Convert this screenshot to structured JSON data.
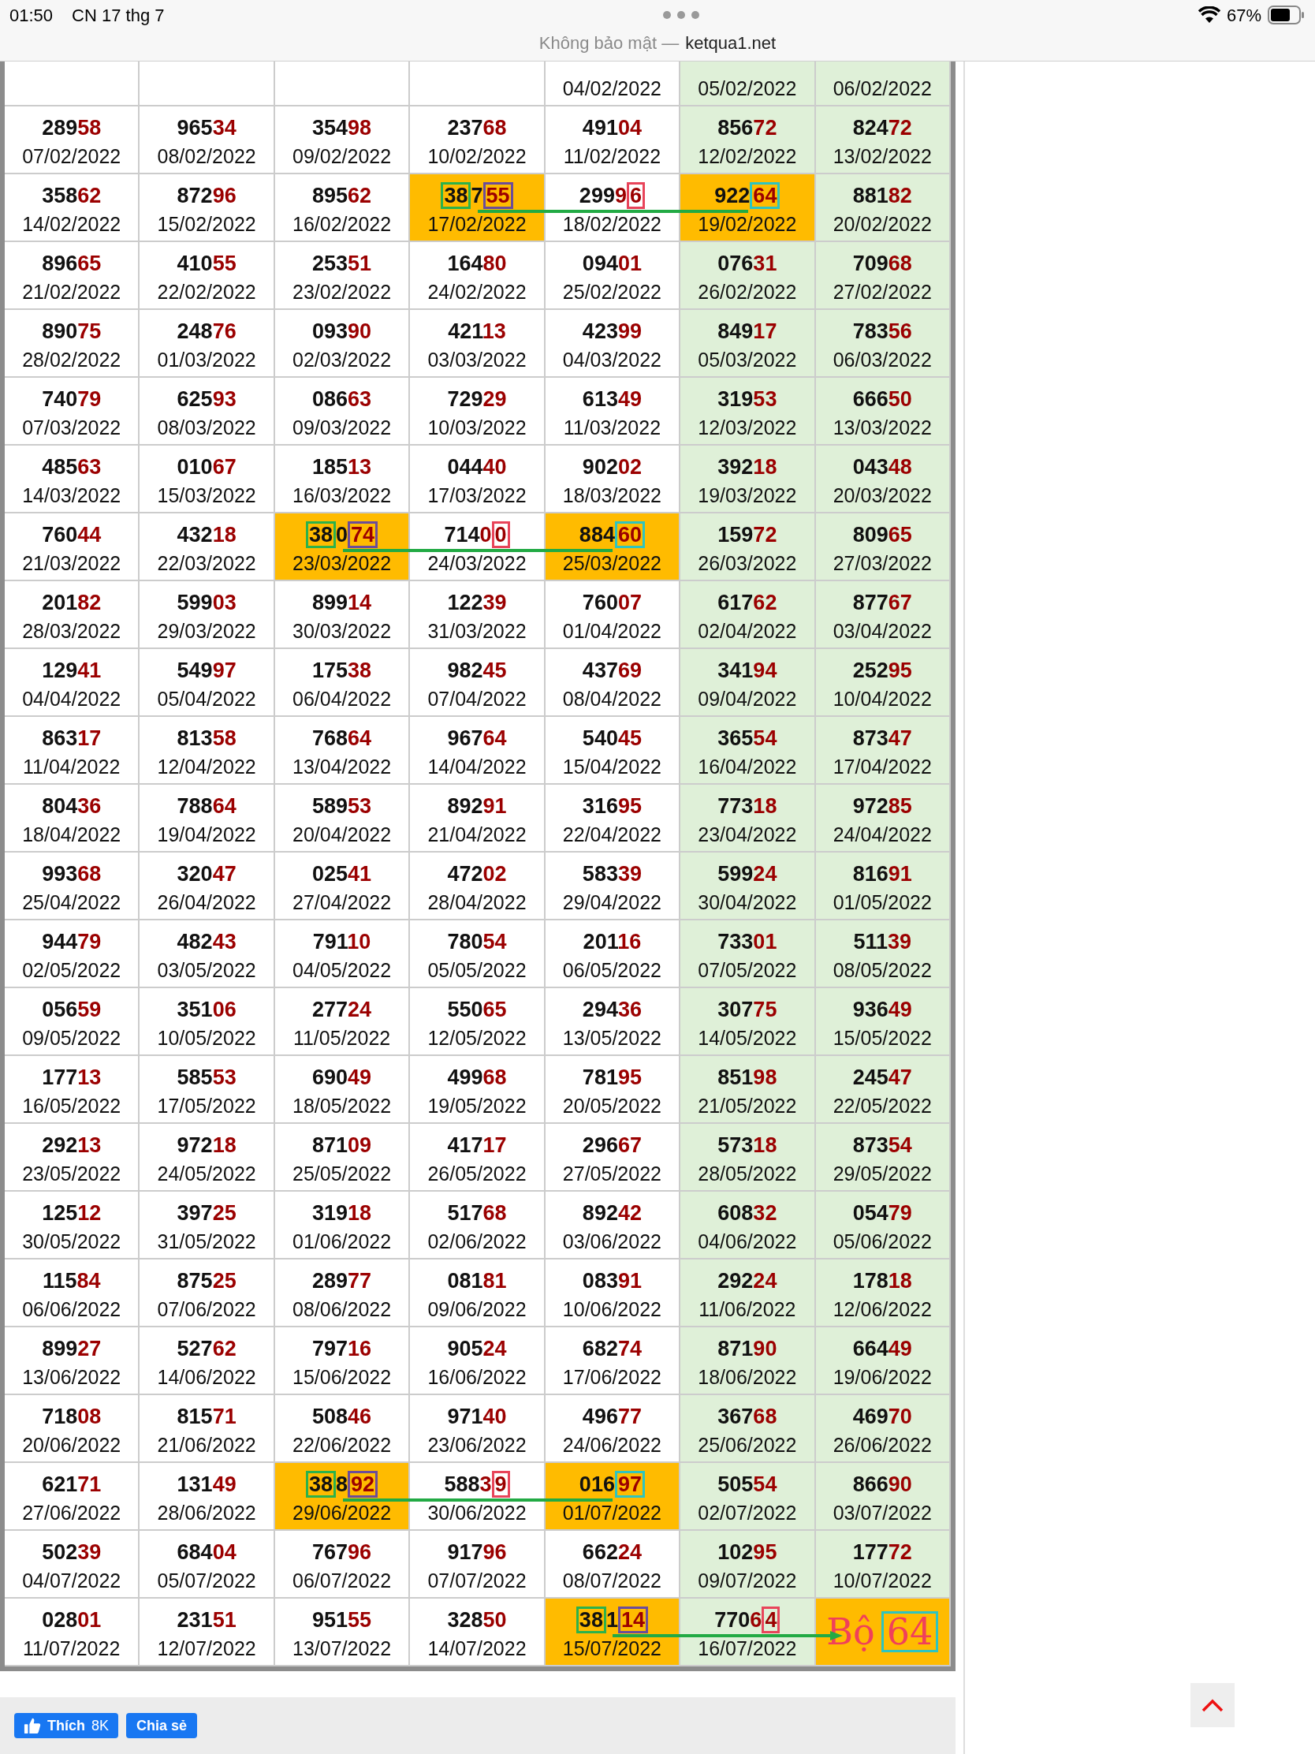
{
  "status_bar": {
    "time": "01:50",
    "date": "CN 17 thg 7",
    "battery": "67%"
  },
  "address_bar": {
    "security": "Không bảo mật —",
    "domain": "ketqua1.net"
  },
  "rows": [
    {
      "connector": false,
      "arrow": false,
      "cells": [
        {
          "kind": "cut",
          "weekend": false,
          "highlighted": false
        },
        {
          "kind": "cut",
          "weekend": false,
          "highlighted": false
        },
        {
          "kind": "cut",
          "weekend": false,
          "highlighted": false
        },
        {
          "kind": "cut",
          "weekend": false,
          "highlighted": false
        },
        {
          "date": "04/02/2022",
          "weekend": false,
          "highlighted": false
        },
        {
          "date": "05/02/2022",
          "weekend": true,
          "highlighted": false
        },
        {
          "date": "06/02/2022",
          "weekend": true,
          "highlighted": false
        }
      ]
    },
    {
      "connector": false,
      "arrow": false,
      "cells": [
        {
          "head": "289",
          "tail": "58",
          "date": "07/02/2022",
          "weekend": false,
          "highlighted": false
        },
        {
          "head": "965",
          "tail": "34",
          "date": "08/02/2022",
          "weekend": false,
          "highlighted": false
        },
        {
          "head": "354",
          "tail": "98",
          "date": "09/02/2022",
          "weekend": false,
          "highlighted": false
        },
        {
          "head": "237",
          "tail": "68",
          "date": "10/02/2022",
          "weekend": false,
          "highlighted": false
        },
        {
          "head": "491",
          "tail": "04",
          "date": "11/02/2022",
          "weekend": false,
          "highlighted": false
        },
        {
          "head": "856",
          "tail": "72",
          "date": "12/02/2022",
          "weekend": true,
          "highlighted": false
        },
        {
          "head": "824",
          "tail": "72",
          "date": "13/02/2022",
          "weekend": true,
          "highlighted": false
        }
      ]
    },
    {
      "connector": true,
      "arrow": false,
      "cells": [
        {
          "head": "358",
          "tail": "62",
          "date": "14/02/2022",
          "weekend": false,
          "highlighted": false
        },
        {
          "head": "872",
          "tail": "96",
          "date": "15/02/2022",
          "weekend": false,
          "highlighted": false
        },
        {
          "head": "895",
          "tail": "62",
          "date": "16/02/2022",
          "weekend": false,
          "highlighted": false
        },
        {
          "parts": [
            {
              "text": "38",
              "red": false,
              "color": "#2bb24c"
            },
            {
              "text": "7",
              "red": false
            },
            {
              "text": "55",
              "red": true,
              "color": "#6b4c9a"
            }
          ],
          "date": "17/02/2022",
          "highlighted": true
        },
        {
          "parts": [
            {
              "text": "299",
              "red": false
            },
            {
              "text": "9",
              "red": true
            },
            {
              "text": "6",
              "red": true,
              "color": "#e8445a"
            }
          ],
          "date": "18/02/2022",
          "weekend": false,
          "highlighted": false
        },
        {
          "parts": [
            {
              "text": "922",
              "red": false
            },
            {
              "text": "64",
              "red": true,
              "color": "#2ec4c0"
            }
          ],
          "date": "19/02/2022",
          "highlighted": true
        },
        {
          "head": "881",
          "tail": "82",
          "date": "20/02/2022",
          "weekend": true,
          "highlighted": false
        }
      ]
    },
    {
      "connector": false,
      "arrow": false,
      "cells": [
        {
          "head": "896",
          "tail": "65",
          "date": "21/02/2022",
          "weekend": false,
          "highlighted": false
        },
        {
          "head": "410",
          "tail": "55",
          "date": "22/02/2022",
          "weekend": false,
          "highlighted": false
        },
        {
          "head": "253",
          "tail": "51",
          "date": "23/02/2022",
          "weekend": false,
          "highlighted": false
        },
        {
          "head": "164",
          "tail": "80",
          "date": "24/02/2022",
          "weekend": false,
          "highlighted": false
        },
        {
          "head": "094",
          "tail": "01",
          "date": "25/02/2022",
          "weekend": false,
          "highlighted": false
        },
        {
          "head": "076",
          "tail": "31",
          "date": "26/02/2022",
          "weekend": true,
          "highlighted": false
        },
        {
          "head": "709",
          "tail": "68",
          "date": "27/02/2022",
          "weekend": true,
          "highlighted": false
        }
      ]
    },
    {
      "connector": false,
      "arrow": false,
      "cells": [
        {
          "head": "890",
          "tail": "75",
          "date": "28/02/2022",
          "weekend": false,
          "highlighted": false
        },
        {
          "head": "248",
          "tail": "76",
          "date": "01/03/2022",
          "weekend": false,
          "highlighted": false
        },
        {
          "head": "093",
          "tail": "90",
          "date": "02/03/2022",
          "weekend": false,
          "highlighted": false
        },
        {
          "head": "421",
          "tail": "13",
          "date": "03/03/2022",
          "weekend": false,
          "highlighted": false
        },
        {
          "head": "423",
          "tail": "99",
          "date": "04/03/2022",
          "weekend": false,
          "highlighted": false
        },
        {
          "head": "849",
          "tail": "17",
          "date": "05/03/2022",
          "weekend": true,
          "highlighted": false
        },
        {
          "head": "783",
          "tail": "56",
          "date": "06/03/2022",
          "weekend": true,
          "highlighted": false
        }
      ]
    },
    {
      "connector": false,
      "arrow": false,
      "cells": [
        {
          "head": "740",
          "tail": "79",
          "date": "07/03/2022",
          "weekend": false,
          "highlighted": false
        },
        {
          "head": "625",
          "tail": "93",
          "date": "08/03/2022",
          "weekend": false,
          "highlighted": false
        },
        {
          "head": "086",
          "tail": "63",
          "date": "09/03/2022",
          "weekend": false,
          "highlighted": false
        },
        {
          "head": "729",
          "tail": "29",
          "date": "10/03/2022",
          "weekend": false,
          "highlighted": false
        },
        {
          "head": "613",
          "tail": "49",
          "date": "11/03/2022",
          "weekend": false,
          "highlighted": false
        },
        {
          "head": "319",
          "tail": "53",
          "date": "12/03/2022",
          "weekend": true,
          "highlighted": false
        },
        {
          "head": "666",
          "tail": "50",
          "date": "13/03/2022",
          "weekend": true,
          "highlighted": false
        }
      ]
    },
    {
      "connector": false,
      "arrow": false,
      "cells": [
        {
          "head": "485",
          "tail": "63",
          "date": "14/03/2022",
          "weekend": false,
          "highlighted": false
        },
        {
          "head": "010",
          "tail": "67",
          "date": "15/03/2022",
          "weekend": false,
          "highlighted": false
        },
        {
          "head": "185",
          "tail": "13",
          "date": "16/03/2022",
          "weekend": false,
          "highlighted": false
        },
        {
          "head": "044",
          "tail": "40",
          "date": "17/03/2022",
          "weekend": false,
          "highlighted": false
        },
        {
          "head": "902",
          "tail": "02",
          "date": "18/03/2022",
          "weekend": false,
          "highlighted": false
        },
        {
          "head": "392",
          "tail": "18",
          "date": "19/03/2022",
          "weekend": true,
          "highlighted": false
        },
        {
          "head": "043",
          "tail": "48",
          "date": "20/03/2022",
          "weekend": true,
          "highlighted": false
        }
      ]
    },
    {
      "connector": true,
      "arrow": false,
      "cells": [
        {
          "head": "760",
          "tail": "44",
          "date": "21/03/2022",
          "weekend": false,
          "highlighted": false
        },
        {
          "head": "432",
          "tail": "18",
          "date": "22/03/2022",
          "weekend": false,
          "highlighted": false
        },
        {
          "parts": [
            {
              "text": "38",
              "red": false,
              "color": "#2bb24c"
            },
            {
              "text": "0",
              "red": false
            },
            {
              "text": "74",
              "red": true,
              "color": "#6b4c9a"
            }
          ],
          "date": "23/03/2022",
          "highlighted": true
        },
        {
          "parts": [
            {
              "text": "714",
              "red": false
            },
            {
              "text": "0",
              "red": true
            },
            {
              "text": "0",
              "red": true,
              "color": "#e8445a"
            }
          ],
          "date": "24/03/2022",
          "weekend": false,
          "highlighted": false
        },
        {
          "parts": [
            {
              "text": "884",
              "red": false
            },
            {
              "text": "60",
              "red": true,
              "color": "#2ec4c0"
            }
          ],
          "date": "25/03/2022",
          "highlighted": true
        },
        {
          "head": "159",
          "tail": "72",
          "date": "26/03/2022",
          "weekend": true,
          "highlighted": false
        },
        {
          "head": "809",
          "tail": "65",
          "date": "27/03/2022",
          "weekend": true,
          "highlighted": false
        }
      ]
    },
    {
      "connector": false,
      "arrow": false,
      "cells": [
        {
          "head": "201",
          "tail": "82",
          "date": "28/03/2022",
          "weekend": false,
          "highlighted": false
        },
        {
          "head": "599",
          "tail": "03",
          "date": "29/03/2022",
          "weekend": false,
          "highlighted": false
        },
        {
          "head": "899",
          "tail": "14",
          "date": "30/03/2022",
          "weekend": false,
          "highlighted": false
        },
        {
          "head": "122",
          "tail": "39",
          "date": "31/03/2022",
          "weekend": false,
          "highlighted": false
        },
        {
          "head": "760",
          "tail": "07",
          "date": "01/04/2022",
          "weekend": false,
          "highlighted": false
        },
        {
          "head": "617",
          "tail": "62",
          "date": "02/04/2022",
          "weekend": true,
          "highlighted": false
        },
        {
          "head": "877",
          "tail": "67",
          "date": "03/04/2022",
          "weekend": true,
          "highlighted": false
        }
      ]
    },
    {
      "connector": false,
      "arrow": false,
      "cells": [
        {
          "head": "129",
          "tail": "41",
          "date": "04/04/2022",
          "weekend": false,
          "highlighted": false
        },
        {
          "head": "549",
          "tail": "97",
          "date": "05/04/2022",
          "weekend": false,
          "highlighted": false
        },
        {
          "head": "175",
          "tail": "38",
          "date": "06/04/2022",
          "weekend": false,
          "highlighted": false
        },
        {
          "head": "982",
          "tail": "45",
          "date": "07/04/2022",
          "weekend": false,
          "highlighted": false
        },
        {
          "head": "437",
          "tail": "69",
          "date": "08/04/2022",
          "weekend": false,
          "highlighted": false
        },
        {
          "head": "341",
          "tail": "94",
          "date": "09/04/2022",
          "weekend": true,
          "highlighted": false
        },
        {
          "head": "252",
          "tail": "95",
          "date": "10/04/2022",
          "weekend": true,
          "highlighted": false
        }
      ]
    },
    {
      "connector": false,
      "arrow": false,
      "cells": [
        {
          "head": "863",
          "tail": "17",
          "date": "11/04/2022",
          "weekend": false,
          "highlighted": false
        },
        {
          "head": "813",
          "tail": "58",
          "date": "12/04/2022",
          "weekend": false,
          "highlighted": false
        },
        {
          "head": "768",
          "tail": "64",
          "date": "13/04/2022",
          "weekend": false,
          "highlighted": false
        },
        {
          "head": "967",
          "tail": "64",
          "date": "14/04/2022",
          "weekend": false,
          "highlighted": false
        },
        {
          "head": "540",
          "tail": "45",
          "date": "15/04/2022",
          "weekend": false,
          "highlighted": false
        },
        {
          "head": "365",
          "tail": "54",
          "date": "16/04/2022",
          "weekend": true,
          "highlighted": false
        },
        {
          "head": "873",
          "tail": "47",
          "date": "17/04/2022",
          "weekend": true,
          "highlighted": false
        }
      ]
    },
    {
      "connector": false,
      "arrow": false,
      "cells": [
        {
          "head": "804",
          "tail": "36",
          "date": "18/04/2022",
          "weekend": false,
          "highlighted": false
        },
        {
          "head": "788",
          "tail": "64",
          "date": "19/04/2022",
          "weekend": false,
          "highlighted": false
        },
        {
          "head": "589",
          "tail": "53",
          "date": "20/04/2022",
          "weekend": false,
          "highlighted": false
        },
        {
          "head": "892",
          "tail": "91",
          "date": "21/04/2022",
          "weekend": false,
          "highlighted": false
        },
        {
          "head": "316",
          "tail": "95",
          "date": "22/04/2022",
          "weekend": false,
          "highlighted": false
        },
        {
          "head": "773",
          "tail": "18",
          "date": "23/04/2022",
          "weekend": true,
          "highlighted": false
        },
        {
          "head": "972",
          "tail": "85",
          "date": "24/04/2022",
          "weekend": true,
          "highlighted": false
        }
      ]
    },
    {
      "connector": false,
      "arrow": false,
      "cells": [
        {
          "head": "993",
          "tail": "68",
          "date": "25/04/2022",
          "weekend": false,
          "highlighted": false
        },
        {
          "head": "320",
          "tail": "47",
          "date": "26/04/2022",
          "weekend": false,
          "highlighted": false
        },
        {
          "head": "025",
          "tail": "41",
          "date": "27/04/2022",
          "weekend": false,
          "highlighted": false
        },
        {
          "head": "472",
          "tail": "02",
          "date": "28/04/2022",
          "weekend": false,
          "highlighted": false
        },
        {
          "head": "583",
          "tail": "39",
          "date": "29/04/2022",
          "weekend": false,
          "highlighted": false
        },
        {
          "head": "599",
          "tail": "24",
          "date": "30/04/2022",
          "weekend": true,
          "highlighted": false
        },
        {
          "head": "816",
          "tail": "91",
          "date": "01/05/2022",
          "weekend": true,
          "highlighted": false
        }
      ]
    },
    {
      "connector": false,
      "arrow": false,
      "cells": [
        {
          "head": "944",
          "tail": "79",
          "date": "02/05/2022",
          "weekend": false,
          "highlighted": false
        },
        {
          "head": "482",
          "tail": "43",
          "date": "03/05/2022",
          "weekend": false,
          "highlighted": false
        },
        {
          "head": "791",
          "tail": "10",
          "date": "04/05/2022",
          "weekend": false,
          "highlighted": false
        },
        {
          "head": "780",
          "tail": "54",
          "date": "05/05/2022",
          "weekend": false,
          "highlighted": false
        },
        {
          "head": "201",
          "tail": "16",
          "date": "06/05/2022",
          "weekend": false,
          "highlighted": false
        },
        {
          "head": "733",
          "tail": "01",
          "date": "07/05/2022",
          "weekend": true,
          "highlighted": false
        },
        {
          "head": "511",
          "tail": "39",
          "date": "08/05/2022",
          "weekend": true,
          "highlighted": false
        }
      ]
    },
    {
      "connector": false,
      "arrow": false,
      "cells": [
        {
          "head": "056",
          "tail": "59",
          "date": "09/05/2022",
          "weekend": false,
          "highlighted": false
        },
        {
          "head": "351",
          "tail": "06",
          "date": "10/05/2022",
          "weekend": false,
          "highlighted": false
        },
        {
          "head": "277",
          "tail": "24",
          "date": "11/05/2022",
          "weekend": false,
          "highlighted": false
        },
        {
          "head": "550",
          "tail": "65",
          "date": "12/05/2022",
          "weekend": false,
          "highlighted": false
        },
        {
          "head": "294",
          "tail": "36",
          "date": "13/05/2022",
          "weekend": false,
          "highlighted": false
        },
        {
          "head": "307",
          "tail": "75",
          "date": "14/05/2022",
          "weekend": true,
          "highlighted": false
        },
        {
          "head": "936",
          "tail": "49",
          "date": "15/05/2022",
          "weekend": true,
          "highlighted": false
        }
      ]
    },
    {
      "connector": false,
      "arrow": false,
      "cells": [
        {
          "head": "177",
          "tail": "13",
          "date": "16/05/2022",
          "weekend": false,
          "highlighted": false
        },
        {
          "head": "585",
          "tail": "53",
          "date": "17/05/2022",
          "weekend": false,
          "highlighted": false
        },
        {
          "head": "690",
          "tail": "49",
          "date": "18/05/2022",
          "weekend": false,
          "highlighted": false
        },
        {
          "head": "499",
          "tail": "68",
          "date": "19/05/2022",
          "weekend": false,
          "highlighted": false
        },
        {
          "head": "781",
          "tail": "95",
          "date": "20/05/2022",
          "weekend": false,
          "highlighted": false
        },
        {
          "head": "851",
          "tail": "98",
          "date": "21/05/2022",
          "weekend": true,
          "highlighted": false
        },
        {
          "head": "245",
          "tail": "47",
          "date": "22/05/2022",
          "weekend": true,
          "highlighted": false
        }
      ]
    },
    {
      "connector": false,
      "arrow": false,
      "cells": [
        {
          "head": "292",
          "tail": "13",
          "date": "23/05/2022",
          "weekend": false,
          "highlighted": false
        },
        {
          "head": "972",
          "tail": "18",
          "date": "24/05/2022",
          "weekend": false,
          "highlighted": false
        },
        {
          "head": "871",
          "tail": "09",
          "date": "25/05/2022",
          "weekend": false,
          "highlighted": false
        },
        {
          "head": "417",
          "tail": "17",
          "date": "26/05/2022",
          "weekend": false,
          "highlighted": false
        },
        {
          "head": "296",
          "tail": "67",
          "date": "27/05/2022",
          "weekend": false,
          "highlighted": false
        },
        {
          "head": "573",
          "tail": "18",
          "date": "28/05/2022",
          "weekend": true,
          "highlighted": false
        },
        {
          "head": "873",
          "tail": "54",
          "date": "29/05/2022",
          "weekend": true,
          "highlighted": false
        }
      ]
    },
    {
      "connector": false,
      "arrow": false,
      "cells": [
        {
          "head": "125",
          "tail": "12",
          "date": "30/05/2022",
          "weekend": false,
          "highlighted": false
        },
        {
          "head": "397",
          "tail": "25",
          "date": "31/05/2022",
          "weekend": false,
          "highlighted": false
        },
        {
          "head": "319",
          "tail": "18",
          "date": "01/06/2022",
          "weekend": false,
          "highlighted": false
        },
        {
          "head": "517",
          "tail": "68",
          "date": "02/06/2022",
          "weekend": false,
          "highlighted": false
        },
        {
          "head": "892",
          "tail": "42",
          "date": "03/06/2022",
          "weekend": false,
          "highlighted": false
        },
        {
          "head": "608",
          "tail": "32",
          "date": "04/06/2022",
          "weekend": true,
          "highlighted": false
        },
        {
          "head": "054",
          "tail": "79",
          "date": "05/06/2022",
          "weekend": true,
          "highlighted": false
        }
      ]
    },
    {
      "connector": false,
      "arrow": false,
      "cells": [
        {
          "head": "115",
          "tail": "84",
          "date": "06/06/2022",
          "weekend": false,
          "highlighted": false
        },
        {
          "head": "875",
          "tail": "25",
          "date": "07/06/2022",
          "weekend": false,
          "highlighted": false
        },
        {
          "head": "289",
          "tail": "77",
          "date": "08/06/2022",
          "weekend": false,
          "highlighted": false
        },
        {
          "head": "081",
          "tail": "81",
          "date": "09/06/2022",
          "weekend": false,
          "highlighted": false
        },
        {
          "head": "083",
          "tail": "91",
          "date": "10/06/2022",
          "weekend": false,
          "highlighted": false
        },
        {
          "head": "292",
          "tail": "24",
          "date": "11/06/2022",
          "weekend": true,
          "highlighted": false
        },
        {
          "head": "178",
          "tail": "18",
          "date": "12/06/2022",
          "weekend": true,
          "highlighted": false
        }
      ]
    },
    {
      "connector": false,
      "arrow": false,
      "cells": [
        {
          "head": "899",
          "tail": "27",
          "date": "13/06/2022",
          "weekend": false,
          "highlighted": false
        },
        {
          "head": "527",
          "tail": "62",
          "date": "14/06/2022",
          "weekend": false,
          "highlighted": false
        },
        {
          "head": "797",
          "tail": "16",
          "date": "15/06/2022",
          "weekend": false,
          "highlighted": false
        },
        {
          "head": "905",
          "tail": "24",
          "date": "16/06/2022",
          "weekend": false,
          "highlighted": false
        },
        {
          "head": "682",
          "tail": "74",
          "date": "17/06/2022",
          "weekend": false,
          "highlighted": false
        },
        {
          "head": "871",
          "tail": "90",
          "date": "18/06/2022",
          "weekend": true,
          "highlighted": false
        },
        {
          "head": "664",
          "tail": "49",
          "date": "19/06/2022",
          "weekend": true,
          "highlighted": false
        }
      ]
    },
    {
      "connector": false,
      "arrow": false,
      "cells": [
        {
          "head": "718",
          "tail": "08",
          "date": "20/06/2022",
          "weekend": false,
          "highlighted": false
        },
        {
          "head": "815",
          "tail": "71",
          "date": "21/06/2022",
          "weekend": false,
          "highlighted": false
        },
        {
          "head": "508",
          "tail": "46",
          "date": "22/06/2022",
          "weekend": false,
          "highlighted": false
        },
        {
          "head": "971",
          "tail": "40",
          "date": "23/06/2022",
          "weekend": false,
          "highlighted": false
        },
        {
          "head": "496",
          "tail": "77",
          "date": "24/06/2022",
          "weekend": false,
          "highlighted": false
        },
        {
          "head": "367",
          "tail": "68",
          "date": "25/06/2022",
          "weekend": true,
          "highlighted": false
        },
        {
          "head": "469",
          "tail": "70",
          "date": "26/06/2022",
          "weekend": true,
          "highlighted": false
        }
      ]
    },
    {
      "connector": true,
      "arrow": false,
      "cells": [
        {
          "head": "621",
          "tail": "71",
          "date": "27/06/2022",
          "weekend": false,
          "highlighted": false
        },
        {
          "head": "131",
          "tail": "49",
          "date": "28/06/2022",
          "weekend": false,
          "highlighted": false
        },
        {
          "parts": [
            {
              "text": "38",
              "red": false,
              "color": "#2bb24c"
            },
            {
              "text": "8",
              "red": false
            },
            {
              "text": "92",
              "red": true,
              "color": "#6b4c9a"
            }
          ],
          "date": "29/06/2022",
          "highlighted": true
        },
        {
          "parts": [
            {
              "text": "588",
              "red": false
            },
            {
              "text": "3",
              "red": true
            },
            {
              "text": "9",
              "red": true,
              "color": "#e8445a"
            }
          ],
          "date": "30/06/2022",
          "weekend": false,
          "highlighted": false
        },
        {
          "parts": [
            {
              "text": "016",
              "red": false
            },
            {
              "text": "97",
              "red": true,
              "color": "#2ec4c0"
            }
          ],
          "date": "01/07/2022",
          "highlighted": true
        },
        {
          "head": "505",
          "tail": "54",
          "date": "02/07/2022",
          "weekend": true,
          "highlighted": false
        },
        {
          "head": "866",
          "tail": "90",
          "date": "03/07/2022",
          "weekend": true,
          "highlighted": false
        }
      ]
    },
    {
      "connector": false,
      "arrow": false,
      "cells": [
        {
          "head": "502",
          "tail": "39",
          "date": "04/07/2022",
          "weekend": false,
          "highlighted": false
        },
        {
          "head": "684",
          "tail": "04",
          "date": "05/07/2022",
          "weekend": false,
          "highlighted": false
        },
        {
          "head": "767",
          "tail": "96",
          "date": "06/07/2022",
          "weekend": false,
          "highlighted": false
        },
        {
          "head": "917",
          "tail": "96",
          "date": "07/07/2022",
          "weekend": false,
          "highlighted": false
        },
        {
          "head": "662",
          "tail": "24",
          "date": "08/07/2022",
          "weekend": false,
          "highlighted": false
        },
        {
          "head": "102",
          "tail": "95",
          "date": "09/07/2022",
          "weekend": true,
          "highlighted": false
        },
        {
          "head": "177",
          "tail": "72",
          "date": "10/07/2022",
          "weekend": true,
          "highlighted": false
        }
      ]
    },
    {
      "connector": true,
      "arrow": true,
      "cells": [
        {
          "head": "028",
          "tail": "01",
          "date": "11/07/2022",
          "weekend": false,
          "highlighted": false
        },
        {
          "head": "231",
          "tail": "51",
          "date": "12/07/2022",
          "weekend": false,
          "highlighted": false
        },
        {
          "head": "951",
          "tail": "55",
          "date": "13/07/2022",
          "weekend": false,
          "highlighted": false
        },
        {
          "head": "328",
          "tail": "50",
          "date": "14/07/2022",
          "weekend": false,
          "highlighted": false
        },
        {
          "parts": [
            {
              "text": "38",
              "red": false,
              "color": "#2bb24c"
            },
            {
              "text": "1",
              "red": false
            },
            {
              "text": "14",
              "red": true,
              "color": "#6b4c9a"
            }
          ],
          "date": "15/07/2022",
          "highlighted": true
        },
        {
          "parts": [
            {
              "text": "770",
              "red": false
            },
            {
              "text": "6",
              "red": true
            },
            {
              "text": "4",
              "red": true,
              "color": "#e8445a"
            }
          ],
          "date": "16/07/2022",
          "weekend": true,
          "highlighted": false
        },
        {
          "kind": "note",
          "note": "Bộ",
          "boxed": "64",
          "color": "#2ec4c0",
          "highlighted": true
        }
      ]
    }
  ],
  "footer": {
    "like_label": "Thích",
    "like_count": "8K",
    "share_label": "Chia sẻ"
  }
}
